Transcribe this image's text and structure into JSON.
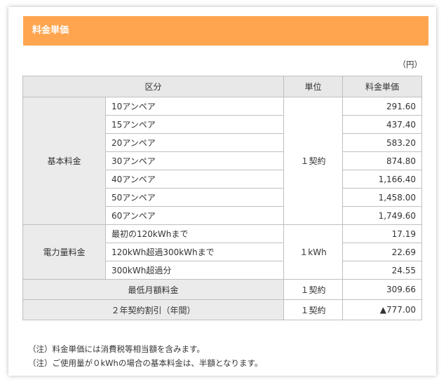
{
  "title": "料金単価",
  "unit_note": "（円）",
  "table": {
    "headers": {
      "category": "区分",
      "unit": "単位",
      "price": "料金単価"
    },
    "basic": {
      "label": "基本料金",
      "unit": "１契約",
      "rows": [
        {
          "item": "10アンペア",
          "price": "291.60"
        },
        {
          "item": "15アンペア",
          "price": "437.40"
        },
        {
          "item": "20アンペア",
          "price": "583.20"
        },
        {
          "item": "30アンペア",
          "price": "874.80"
        },
        {
          "item": "40アンペア",
          "price": "1,166.40"
        },
        {
          "item": "50アンペア",
          "price": "1,458.00"
        },
        {
          "item": "60アンペア",
          "price": "1,749.60"
        }
      ]
    },
    "energy": {
      "label": "電力量料金",
      "unit": "１kWh",
      "rows": [
        {
          "item": "最初の120kWhまで",
          "price": "17.19"
        },
        {
          "item": "120kWh超過300kWhまで",
          "price": "22.69"
        },
        {
          "item": "300kWh超過分",
          "price": "24.55"
        }
      ]
    },
    "minimum": {
      "label": "最低月額料金",
      "unit": "１契約",
      "price": "309.66"
    },
    "discount": {
      "label": "２年契約割引（年間）",
      "unit": "１契約",
      "price": "▲777.00"
    }
  },
  "notes": [
    "（注）料金単価には消費税等相当額を含みます。",
    "（注）ご使用量が０kWhの場合の基本料金は、半額となります。"
  ]
}
